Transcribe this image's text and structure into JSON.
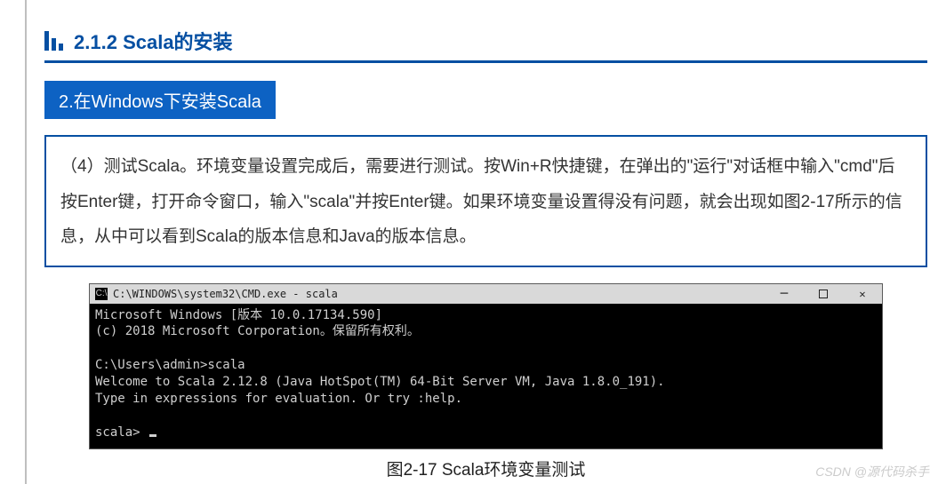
{
  "section": {
    "number": "2.1.2",
    "title": "Scala的安装"
  },
  "subsection": {
    "label": "2.在Windows下安装Scala"
  },
  "instruction": {
    "text": "（4）测试Scala。环境变量设置完成后，需要进行测试。按Win+R快捷键，在弹出的\"运行\"对话框中输入\"cmd\"后按Enter键，打开命令窗口，输入\"scala\"并按Enter键。如果环境变量设置得没有问题，就会出现如图2-17所示的信息，从中可以看到Scala的版本信息和Java的版本信息。"
  },
  "terminal": {
    "titlebar_icon": "C:\\",
    "titlebar_text": "C:\\WINDOWS\\system32\\CMD.exe - scala",
    "lines": {
      "l1": "Microsoft Windows [版本 10.0.17134.590]",
      "l2": "(c) 2018 Microsoft Corporation。保留所有权利。",
      "l3": "",
      "l4": "C:\\Users\\admin>scala",
      "l5": "Welcome to Scala 2.12.8 (Java HotSpot(TM) 64-Bit Server VM, Java 1.8.0_191).",
      "l6": "Type in expressions for evaluation. Or try :help.",
      "l7": "",
      "l8": "scala> "
    }
  },
  "figure": {
    "caption": "图2-17  Scala环境变量测试"
  },
  "watermark": "CSDN @源代码杀手"
}
